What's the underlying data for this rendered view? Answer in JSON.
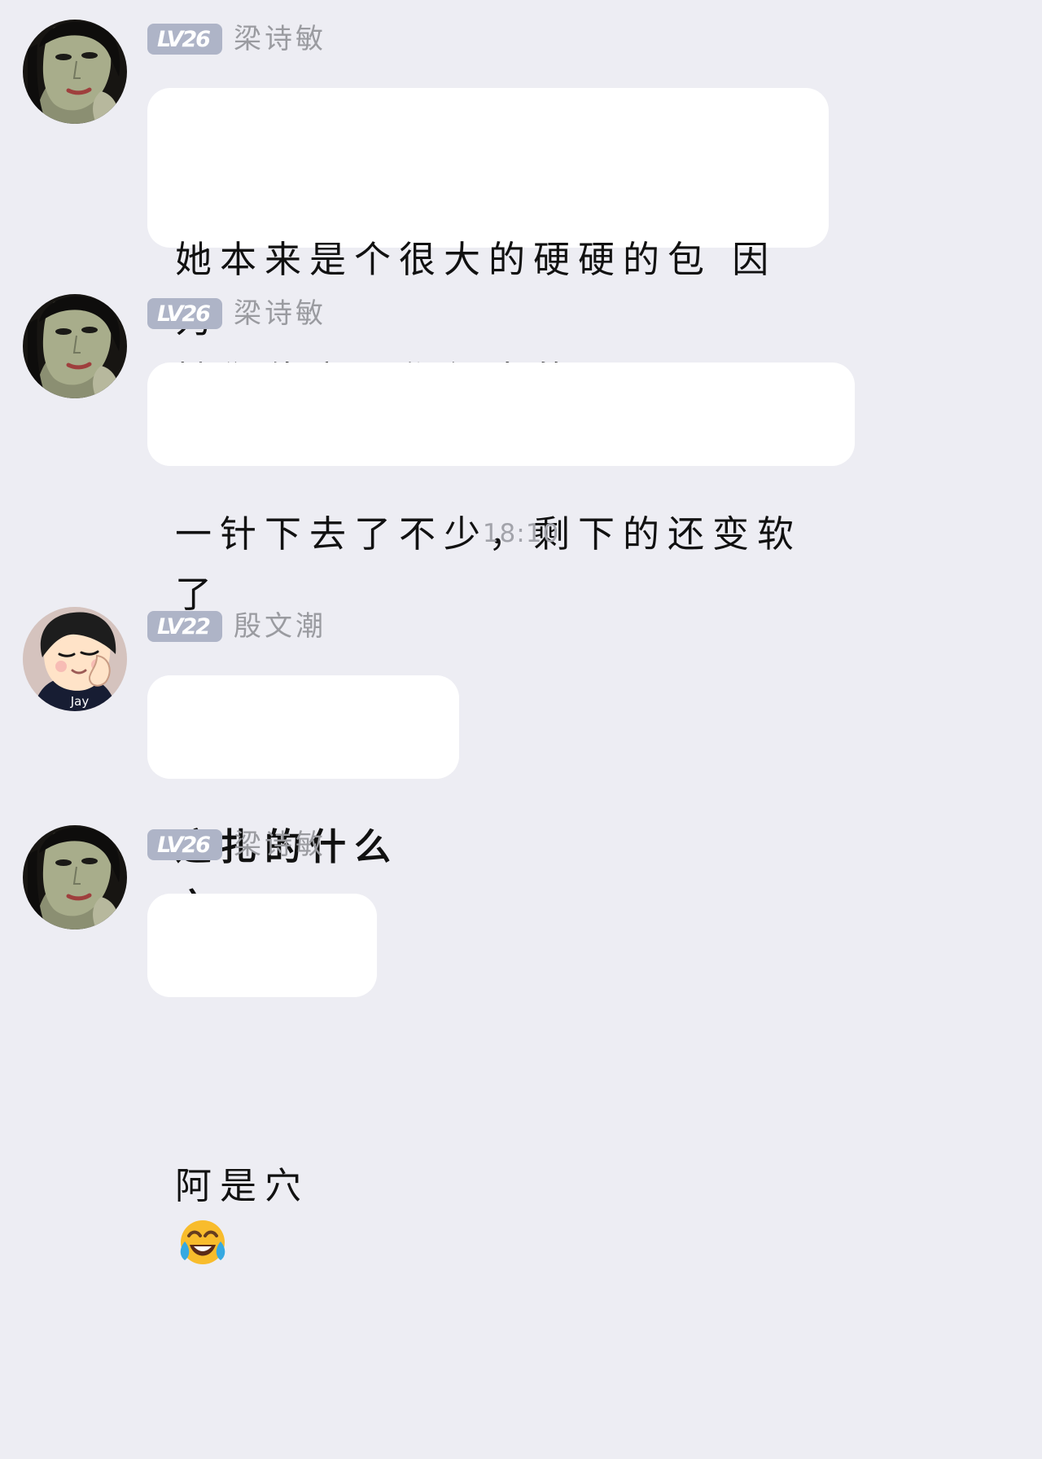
{
  "chat": {
    "timestamp": "18:10",
    "messages": [
      {
        "level": "LV26",
        "sender": "梁诗敏",
        "avatar": "woman-avatar",
        "text": "她本来是个很大的硬硬的包 因为\n她们伏案工作很卷的"
      },
      {
        "level": "LV26",
        "sender": "梁诗敏",
        "avatar": "woman-avatar",
        "text": "一针下去了不少，剩下的还变软了"
      },
      {
        "level": "LV22",
        "sender": "殷文潮",
        "avatar": "jay-cartoon-avatar",
        "avatar_label": "Jay",
        "text": "这扎的什么穴"
      },
      {
        "level": "LV26",
        "sender": "梁诗敏",
        "avatar": "woman-avatar",
        "text": "阿是穴",
        "emoji": "laughing-with-tears-emoji"
      }
    ]
  }
}
